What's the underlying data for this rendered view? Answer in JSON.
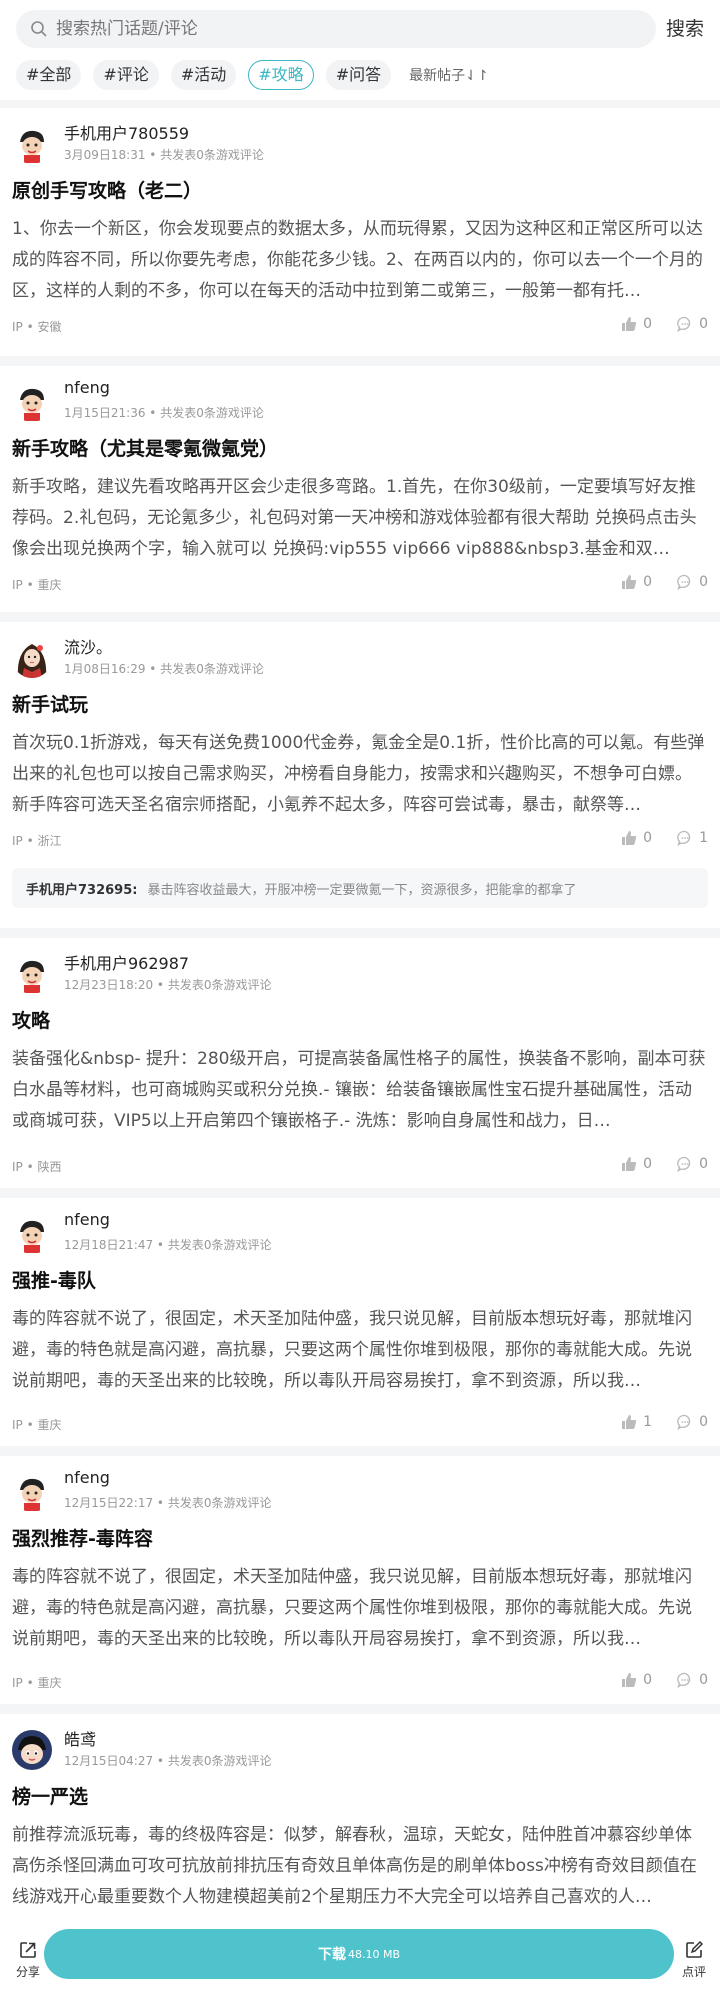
{
  "search": {
    "placeholder": "搜索热门话题/评论",
    "button_label": "搜索"
  },
  "filters": {
    "tags": [
      "#全部",
      "#评论",
      "#活动",
      "#攻略",
      "#问答"
    ],
    "active": "#攻略",
    "sort_label": "最新帖子⇃↾"
  },
  "posts": [
    {
      "username": "手机用户780559",
      "meta": "3月09日18:31 • 共发表0条游戏评论",
      "title": "原创手写攻略（老二）",
      "body": "1、你去一个新区，你会发现要点的数据太多，从而玩得累，又因为这种区和正常区所可以达成的阵容不同，所以你要先考虑，你能花多少钱。2、在两百以内的，你可以去一个一个月的区，这样的人剩的不多，你可以在每天的活动中拉到第二或第三，一般第一都有托…",
      "ip": "IP • 安徽",
      "likes": "0",
      "comments": "0",
      "avatar": "cartoon-boy-icon"
    },
    {
      "username": "nfeng",
      "meta": "1月15日21:36 • 共发表0条游戏评论",
      "title": "新手攻略（尤其是零氪微氪党）",
      "body": "新手攻略，建议先看攻略再开区会少走很多弯路。1.首先，在你30级前，一定要填写好友推荐码。2.礼包码，无论氪多少，礼包码对第一天冲榜和游戏体验都有很大帮助 兑换码点击头像会出现兑换两个字，输入就可以 兑换码:vip555 vip666 vip888&nbsp3.基金和双…",
      "ip": "IP • 重庆",
      "likes": "0",
      "comments": "0",
      "avatar": "cartoon-boy-icon"
    },
    {
      "username": "流沙。",
      "meta": "1月08日16:29 • 共发表0条游戏评论",
      "title": "新手试玩",
      "body": "首次玩0.1折游戏，每天有送免费1000代金券，氪金全是0.1折，性价比高的可以氪。有些弹出来的礼包也可以按自己需求购买，冲榜看自身能力，按需求和兴趣购买，不想争可白嫖。新手阵容可选天圣名宿宗师搭配，小氪养不起太多，阵容可尝试毒，暴击，献祭等…",
      "ip": "IP • 浙江",
      "likes": "0",
      "comments": "1",
      "avatar": "anime-girl-icon",
      "reply": {
        "user": "手机用户732695:",
        "text": "暴击阵容收益最大，开服冲榜一定要微氪一下，资源很多，把能拿的都拿了"
      }
    },
    {
      "username": "手机用户962987",
      "meta": "12月23日18:20 • 共发表0条游戏评论",
      "title": "攻略",
      "body": "装备强化&nbsp- 提升：280级开启，可提高装备属性格子的属性，换装备不影响，副本可获白水晶等材料，也可商城购买或积分兑换.- 镶嵌：给装备镶嵌属性宝石提升基础属性，活动或商城可获，VIP5以上开启第四个镶嵌格子.- 洗炼：影响自身属性和战力，日…",
      "ip": "IP • 陕西",
      "likes": "0",
      "comments": "0",
      "avatar": "cartoon-boy-icon"
    },
    {
      "username": "nfeng",
      "meta": "12月18日21:47 • 共发表0条游戏评论",
      "title": "强推-毒队",
      "body": "毒的阵容就不说了，很固定，术天圣加陆仲盛，我只说见解，目前版本想玩好毒，那就堆闪避，毒的特色就是高闪避，高抗暴，只要这两个属性你堆到极限，那你的毒就能大成。先说说前期吧，毒的天圣出来的比较晚，所以毒队开局容易挨打，拿不到资源，所以我…",
      "ip": "IP • 重庆",
      "likes": "1",
      "comments": "0",
      "avatar": "cartoon-boy-icon"
    },
    {
      "username": "nfeng",
      "meta": "12月15日22:17 • 共发表0条游戏评论",
      "title": "强烈推荐-毒阵容",
      "body": "毒的阵容就不说了，很固定，术天圣加陆仲盛，我只说见解，目前版本想玩好毒，那就堆闪避，毒的特色就是高闪避，高抗暴，只要这两个属性你堆到极限，那你的毒就能大成。先说说前期吧，毒的天圣出来的比较晚，所以毒队开局容易挨打，拿不到资源，所以我…",
      "ip": "IP • 重庆",
      "likes": "0",
      "comments": "0",
      "avatar": "cartoon-boy-icon"
    },
    {
      "username": "皓鸢",
      "meta": "12月15日04:27 • 共发表0条游戏评论",
      "title": "榜一严选",
      "body": "前推荐流派玩毒，毒的终极阵容是：似梦，解春秋，温琼，天蛇女，陆仲胜首冲慕容纱单体高伤杀怪回满血可攻可抗放前排抗压有奇效且单体高伤是的刷单体boss冲榜有奇效目颜值在线游戏开心最重要数个人物建模超美前2个星期压力不大完全可以培养自己喜欢的人…",
      "avatar": "cartoon-kid-icon"
    }
  ],
  "bottom": {
    "share_label": "分享",
    "download_label": "下载",
    "download_size": "48.10 MB",
    "review_label": "点评"
  }
}
